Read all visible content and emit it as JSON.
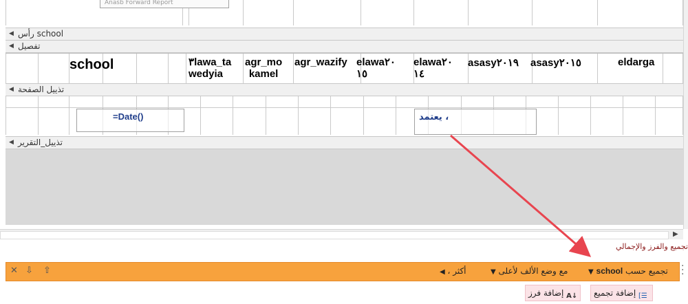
{
  "designer": {
    "top_field": "Anasb Forward Report",
    "bands": {
      "report_header": "رأس school",
      "detail": "تفصيل",
      "page_footer": "تذييل الصفحة",
      "report_footer": "تذييل_التقرير"
    },
    "detail_fields": {
      "school": "school",
      "elawa_tawedyia_1": "٣lawa_ta",
      "elawa_tawedyia_2": "wedyia",
      "agr_mokamel_1": "agr_mo",
      "agr_mokamel_2": "kamel",
      "agr_wazify": "agr_wazify",
      "elawa2015_1": "elawa٢٠",
      "elawa2015_2": "١٥",
      "elawa2014_1": "elawa٢٠",
      "elawa2014_2": "١٤",
      "asasy2019": "asasy٢٠١٩",
      "asasy2015": "asasy٢٠١٥",
      "eldarga": "eldarga"
    },
    "page_footer_fields": {
      "date": "=Date()",
      "approval": "يعتمد ،"
    }
  },
  "group_sort_panel": {
    "title": "تجميع والفرز والإجمالي",
    "group_bar": {
      "group_by_label": "تجميع حسب",
      "group_field": "school",
      "sort_label": "مع وضع الألف لأعلى",
      "more_label": "، أكثر"
    },
    "buttons": {
      "add_group": "إضافة تجميع",
      "add_sort": "إضافة فرز"
    }
  },
  "colors": {
    "group_bar": "#f7a23d",
    "panel_title": "#8b1a1a",
    "arrow": "#e8454f",
    "field_blue": "#1f3d8a"
  }
}
